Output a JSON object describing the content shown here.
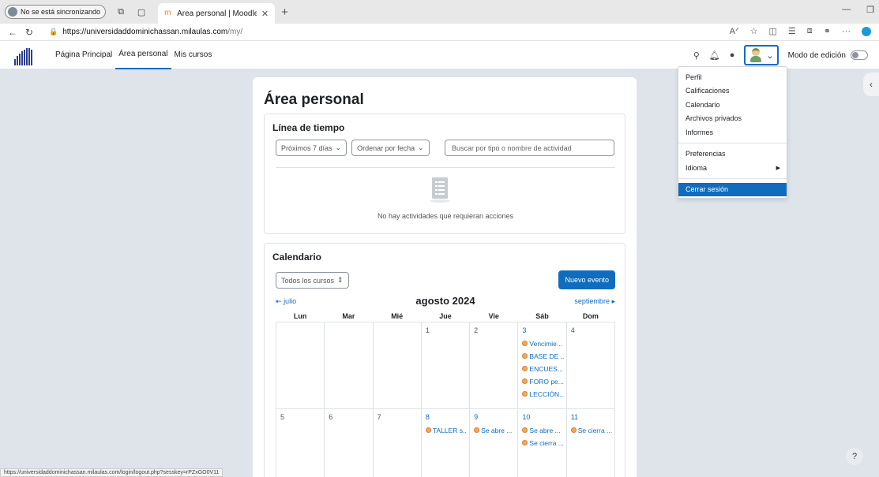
{
  "browser": {
    "profile_label": "No se está sincronizando",
    "tab_title": "Área personal | Moodle",
    "url_host": "https://universidaddominichassan.milaulas.com",
    "url_path": "/my/",
    "status_url": "https://universidaddominichassan.milaulas.com/login/logout.php?sesskey=rPZxGO0V11"
  },
  "navbar": {
    "links": [
      "Página Principal",
      "Área personal",
      "Mis cursos"
    ],
    "edit_mode_label": "Modo de edición"
  },
  "page": {
    "title": "Área personal"
  },
  "timeline": {
    "title": "Línea de tiempo",
    "filter_days": "Próximos 7 días",
    "sort": "Ordenar por fecha",
    "search_placeholder": "Buscar por tipo o nombre de actividad",
    "empty_message": "No hay actividades que requieran acciones"
  },
  "calendar": {
    "title": "Calendario",
    "course_filter": "Todos los cursos",
    "new_event": "Nuevo evento",
    "prev_month": "julio",
    "current_month": "agosto 2024",
    "next_month": "septiembre",
    "weekdays": [
      "Lun",
      "Mar",
      "Mié",
      "Jue",
      "Vie",
      "Sáb",
      "Dom"
    ],
    "weeks": [
      [
        {
          "day": "",
          "events": []
        },
        {
          "day": "",
          "events": []
        },
        {
          "day": "",
          "events": []
        },
        {
          "day": "1",
          "events": []
        },
        {
          "day": "2",
          "events": []
        },
        {
          "day": "3",
          "linked": true,
          "events": [
            "Vencimie...",
            "BASE DE ...",
            "ENCUES...",
            "FORO pe...",
            "LECCIÓN..."
          ]
        },
        {
          "day": "4",
          "events": []
        }
      ],
      [
        {
          "day": "5",
          "events": []
        },
        {
          "day": "6",
          "events": []
        },
        {
          "day": "7",
          "events": []
        },
        {
          "day": "8",
          "linked": true,
          "events": [
            "TALLER s..."
          ]
        },
        {
          "day": "9",
          "linked": true,
          "events": [
            "Se abre ..."
          ]
        },
        {
          "day": "10",
          "linked": true,
          "events": [
            "Se abre ...",
            "Se cierra ..."
          ]
        },
        {
          "day": "11",
          "linked": true,
          "events": [
            "Se cierra ..."
          ]
        }
      ]
    ]
  },
  "user_menu": {
    "items": [
      "Perfil",
      "Calificaciones",
      "Calendario",
      "Archivos privados",
      "Informes"
    ],
    "items2": [
      "Preferencias",
      "Idioma"
    ],
    "logout": "Cerrar sesión"
  },
  "help_label": "?",
  "colors": {
    "primary": "#0f6cbf",
    "event_dot": "#f0ad4e"
  }
}
